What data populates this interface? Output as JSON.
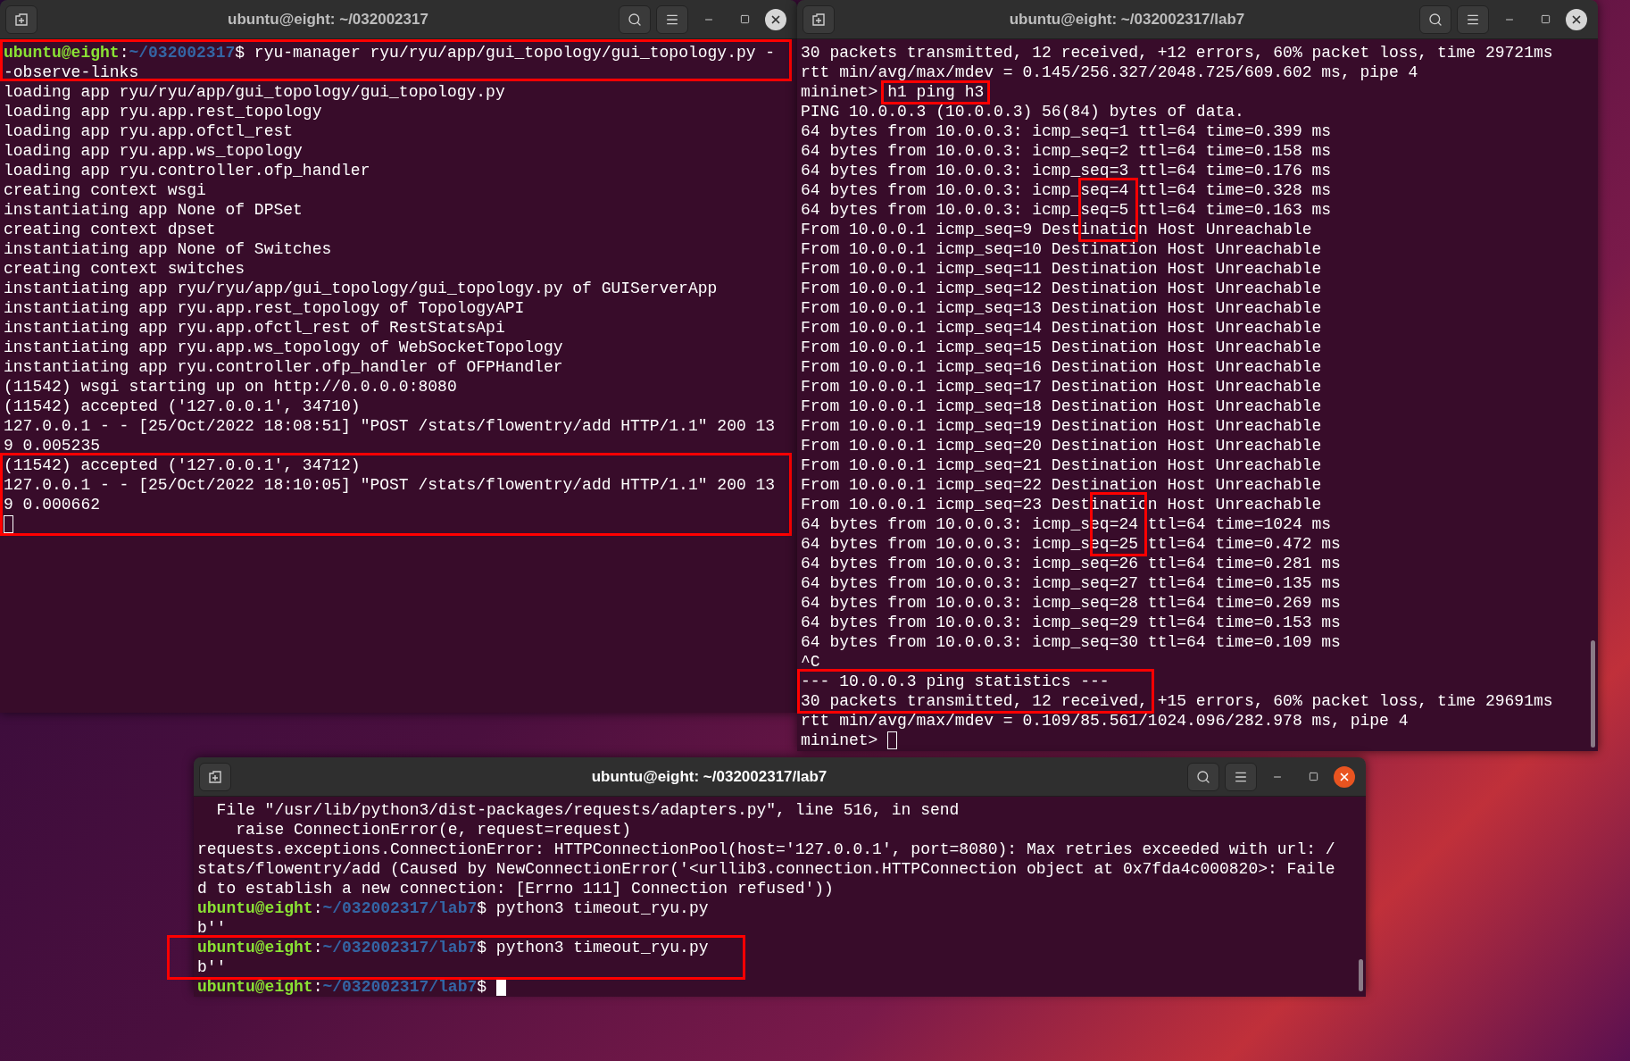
{
  "windows": [
    {
      "title": "ubuntu@eight: ~/032002317",
      "focused": false,
      "scrollbar": false,
      "lines": [
        {
          "segments": [
            {
              "kind": "user",
              "text": "ubuntu@eight"
            },
            {
              "kind": "plain",
              "text": ":"
            },
            {
              "kind": "path",
              "text": "~/032002317"
            },
            {
              "kind": "plain",
              "text": "$ ryu-manager ryu/ryu/app/gui_topology/gui_topology.py -"
            }
          ]
        },
        {
          "text": "-observe-links"
        },
        {
          "text": "loading app ryu/ryu/app/gui_topology/gui_topology.py"
        },
        {
          "text": "loading app ryu.app.rest_topology"
        },
        {
          "text": "loading app ryu.app.ofctl_rest"
        },
        {
          "text": "loading app ryu.app.ws_topology"
        },
        {
          "text": "loading app ryu.controller.ofp_handler"
        },
        {
          "text": "creating context wsgi"
        },
        {
          "text": "instantiating app None of DPSet"
        },
        {
          "text": "creating context dpset"
        },
        {
          "text": "instantiating app None of Switches"
        },
        {
          "text": "creating context switches"
        },
        {
          "text": "instantiating app ryu/ryu/app/gui_topology/gui_topology.py of GUIServerApp"
        },
        {
          "text": "instantiating app ryu.app.rest_topology of TopologyAPI"
        },
        {
          "text": "instantiating app ryu.app.ofctl_rest of RestStatsApi"
        },
        {
          "text": "instantiating app ryu.app.ws_topology of WebSocketTopology"
        },
        {
          "text": "instantiating app ryu.controller.ofp_handler of OFPHandler"
        },
        {
          "text": "(11542) wsgi starting up on http://0.0.0.0:8080"
        },
        {
          "text": "(11542) accepted ('127.0.0.1', 34710)"
        },
        {
          "text": "127.0.0.1 - - [25/Oct/2022 18:08:51] \"POST /stats/flowentry/add HTTP/1.1\" 200 13"
        },
        {
          "text": "9 0.005235"
        },
        {
          "text": "(11542) accepted ('127.0.0.1', 34712)"
        },
        {
          "text": "127.0.0.1 - - [25/Oct/2022 18:10:05] \"POST /stats/flowentry/add HTTP/1.1\" 200 13"
        },
        {
          "text": "9 0.000662"
        },
        {
          "cursor": true
        }
      ]
    },
    {
      "title": "ubuntu@eight: ~/032002317/lab7",
      "focused": false,
      "scrollbar": true,
      "lines": [
        {
          "text": "30 packets transmitted, 12 received, +12 errors, 60% packet loss, time 29721ms"
        },
        {
          "text": "rtt min/avg/max/mdev = 0.145/256.327/2048.725/609.602 ms, pipe 4"
        },
        {
          "prompt": "mininet>",
          "command": "h1 ping h3"
        },
        {
          "text": "PING 10.0.0.3 (10.0.0.3) 56(84) bytes of data."
        },
        {
          "text": "64 bytes from 10.0.0.3: icmp_seq=1 ttl=64 time=0.399 ms"
        },
        {
          "text": "64 bytes from 10.0.0.3: icmp_seq=2 ttl=64 time=0.158 ms"
        },
        {
          "text": "64 bytes from 10.0.0.3: icmp_seq=3 ttl=64 time=0.176 ms"
        },
        {
          "text": "64 bytes from 10.0.0.3: icmp_seq=4 ttl=64 time=0.328 ms"
        },
        {
          "text": "64 bytes from 10.0.0.3: icmp_seq=5 ttl=64 time=0.163 ms"
        },
        {
          "text": "From 10.0.0.1 icmp_seq=9 Destination Host Unreachable"
        },
        {
          "text": "From 10.0.0.1 icmp_seq=10 Destination Host Unreachable"
        },
        {
          "text": "From 10.0.0.1 icmp_seq=11 Destination Host Unreachable"
        },
        {
          "text": "From 10.0.0.1 icmp_seq=12 Destination Host Unreachable"
        },
        {
          "text": "From 10.0.0.1 icmp_seq=13 Destination Host Unreachable"
        },
        {
          "text": "From 10.0.0.1 icmp_seq=14 Destination Host Unreachable"
        },
        {
          "text": "From 10.0.0.1 icmp_seq=15 Destination Host Unreachable"
        },
        {
          "text": "From 10.0.0.1 icmp_seq=16 Destination Host Unreachable"
        },
        {
          "text": "From 10.0.0.1 icmp_seq=17 Destination Host Unreachable"
        },
        {
          "text": "From 10.0.0.1 icmp_seq=18 Destination Host Unreachable"
        },
        {
          "text": "From 10.0.0.1 icmp_seq=19 Destination Host Unreachable"
        },
        {
          "text": "From 10.0.0.1 icmp_seq=20 Destination Host Unreachable"
        },
        {
          "text": "From 10.0.0.1 icmp_seq=21 Destination Host Unreachable"
        },
        {
          "text": "From 10.0.0.1 icmp_seq=22 Destination Host Unreachable"
        },
        {
          "text": "From 10.0.0.1 icmp_seq=23 Destination Host Unreachable"
        },
        {
          "text": "64 bytes from 10.0.0.3: icmp_seq=24 ttl=64 time=1024 ms"
        },
        {
          "text": "64 bytes from 10.0.0.3: icmp_seq=25 ttl=64 time=0.472 ms"
        },
        {
          "text": "64 bytes from 10.0.0.3: icmp_seq=26 ttl=64 time=0.281 ms"
        },
        {
          "text": "64 bytes from 10.0.0.3: icmp_seq=27 ttl=64 time=0.135 ms"
        },
        {
          "text": "64 bytes from 10.0.0.3: icmp_seq=28 ttl=64 time=0.269 ms"
        },
        {
          "text": "64 bytes from 10.0.0.3: icmp_seq=29 ttl=64 time=0.153 ms"
        },
        {
          "text": "64 bytes from 10.0.0.3: icmp_seq=30 ttl=64 time=0.109 ms"
        },
        {
          "text": "^C"
        },
        {
          "text": "--- 10.0.0.3 ping statistics ---"
        },
        {
          "text": "30 packets transmitted, 12 received, +15 errors, 60% packet loss, time 29691ms"
        },
        {
          "text": "rtt min/avg/max/mdev = 0.109/85.561/1024.096/282.978 ms, pipe 4"
        },
        {
          "text": "mininet> ",
          "cursor": true
        }
      ]
    },
    {
      "title": "ubuntu@eight: ~/032002317/lab7",
      "focused": true,
      "scrollbar": true,
      "lines": [
        {
          "text": "  File \"/usr/lib/python3/dist-packages/requests/adapters.py\", line 516, in send"
        },
        {
          "text": "    raise ConnectionError(e, request=request)"
        },
        {
          "text": "requests.exceptions.ConnectionError: HTTPConnectionPool(host='127.0.0.1', port=8080): Max retries exceeded with url: /"
        },
        {
          "text": "stats/flowentry/add (Caused by NewConnectionError('<urllib3.connection.HTTPConnection object at 0x7fda4c000820>: Faile"
        },
        {
          "text": "d to establish a new connection: [Errno 111] Connection refused'))"
        },
        {
          "segments": [
            {
              "kind": "user",
              "text": "ubuntu@eight"
            },
            {
              "kind": "plain",
              "text": ":"
            },
            {
              "kind": "path",
              "text": "~/032002317/lab7"
            },
            {
              "kind": "plain",
              "text": "$ python3 timeout_ryu.py"
            }
          ]
        },
        {
          "text": "b''"
        },
        {
          "segments": [
            {
              "kind": "user",
              "text": "ubuntu@eight"
            },
            {
              "kind": "plain",
              "text": ":"
            },
            {
              "kind": "path",
              "text": "~/032002317/lab7"
            },
            {
              "kind": "plain",
              "text": "$ python3 timeout_ryu.py"
            }
          ]
        },
        {
          "text": "b''"
        },
        {
          "segments": [
            {
              "kind": "user",
              "text": "ubuntu@eight"
            },
            {
              "kind": "plain",
              "text": ":"
            },
            {
              "kind": "path",
              "text": "~/032002317/lab7"
            },
            {
              "kind": "plain",
              "text": "$ "
            }
          ],
          "cursor": true
        }
      ]
    }
  ]
}
